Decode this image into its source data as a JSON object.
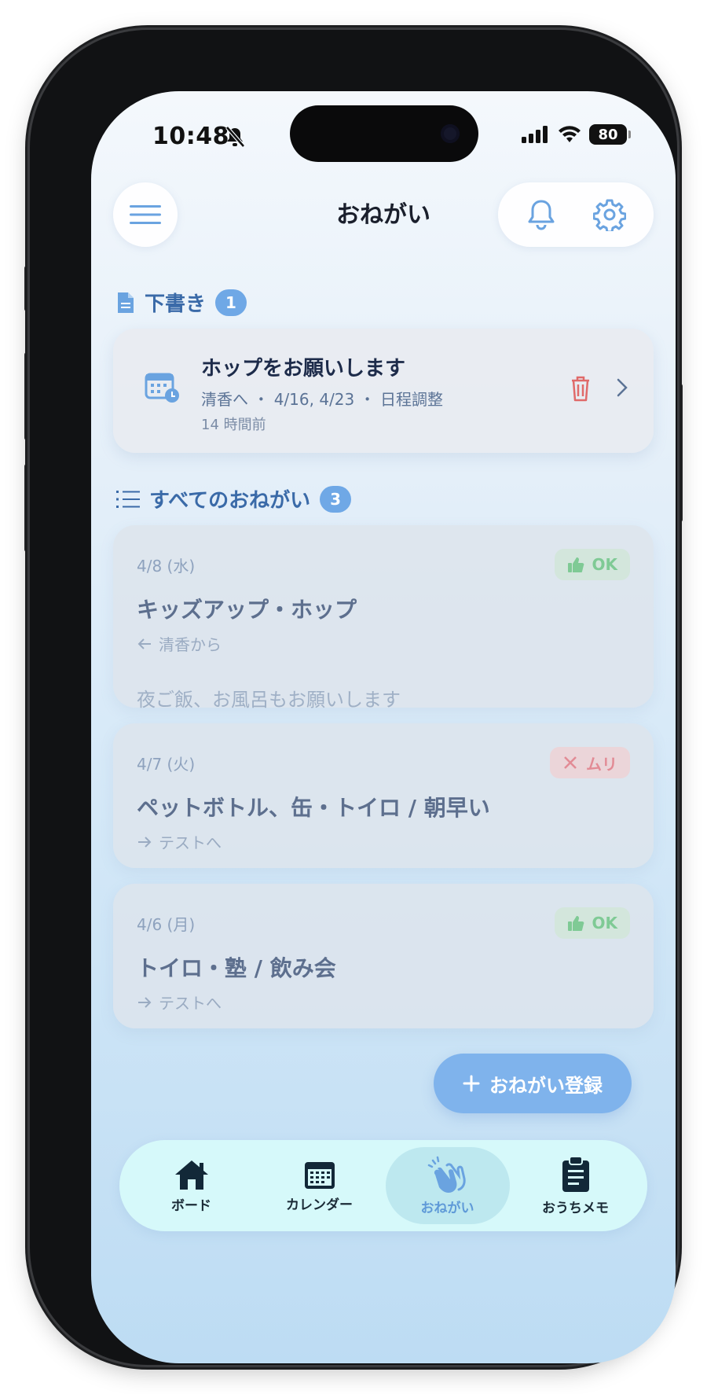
{
  "status_bar": {
    "time": "10:48",
    "battery": "80"
  },
  "header": {
    "title": "おねがい"
  },
  "drafts": {
    "title": "下書き",
    "count": "1",
    "item": {
      "title": "ホップをお願いします",
      "meta": "清香へ ・ 4/16, 4/23 ・ 日程調整",
      "time": "14 時間前"
    }
  },
  "all": {
    "title": "すべてのおねがい",
    "count": "3",
    "items": [
      {
        "date": "4/8 (水)",
        "status": "OK",
        "title": "キッズアップ・ホップ",
        "direction": "清香から",
        "note": "夜ご飯、お風呂もお願いします"
      },
      {
        "date": "4/7 (火)",
        "status": "ムリ",
        "title": "ペットボトル、缶・トイロ / 朝早い",
        "direction": "テストへ"
      },
      {
        "date": "4/6 (月)",
        "status": "OK",
        "title": "トイロ・塾 / 飲み会",
        "direction": "テストへ"
      }
    ]
  },
  "fab": {
    "label": "おねがい登録"
  },
  "tabbar": {
    "items": [
      {
        "label": "ボード",
        "icon": "home-icon"
      },
      {
        "label": "カレンダー",
        "icon": "calendar-icon"
      },
      {
        "label": "おねがい",
        "icon": "waving-hands-icon",
        "active": true
      },
      {
        "label": "おうちメモ",
        "icon": "clipboard-icon"
      }
    ]
  },
  "colors": {
    "accent": "#6fa8e6",
    "ok": "#7fca95",
    "reject": "#e28b95",
    "delete": "#e06a6a",
    "fab": "#7fb3ec"
  }
}
